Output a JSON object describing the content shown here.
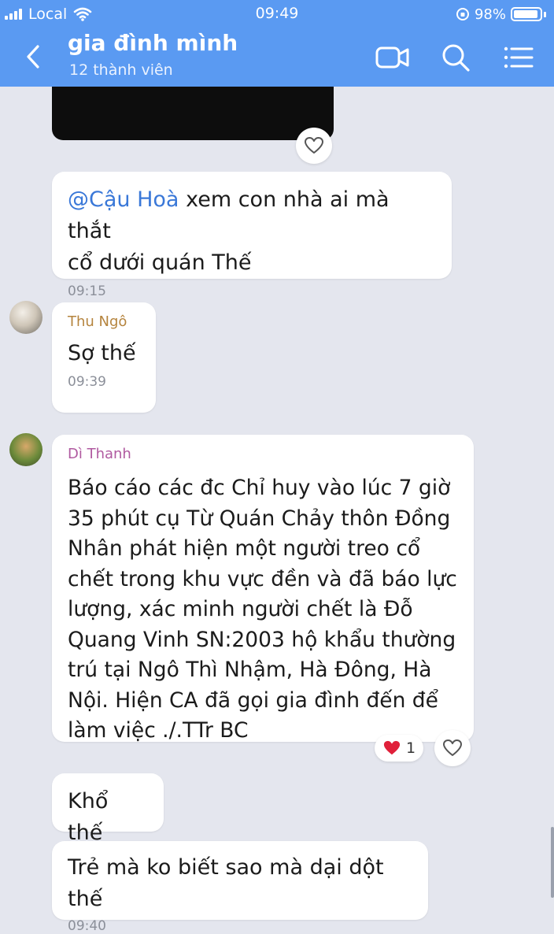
{
  "status_bar": {
    "carrier": "Local",
    "time": "09:49",
    "battery": "98%"
  },
  "header": {
    "title": "gia đình mình",
    "subtitle": "12 thành viên"
  },
  "colors": {
    "header": "#5a9af2",
    "background": "#e4e6ee",
    "mention": "#3a78d8",
    "sender_thu": "#b5843e",
    "sender_thanh": "#b05aa0",
    "heart": "#e0203a"
  },
  "icons": [
    "back-icon",
    "video-call-icon",
    "search-icon",
    "menu-icon",
    "heart-outline-icon",
    "heart-filled-icon"
  ],
  "messages": [
    {
      "mention": "@Cậu Hoà",
      "text_line1": "xem con nhà ai mà thắt",
      "text_line2": "cổ dưới quán Thế",
      "time": "09:15"
    },
    {
      "sender": "Thu Ngô",
      "text": "Sợ thế",
      "time": "09:39"
    },
    {
      "sender": "Dì Thanh",
      "lines": [
        "Báo cáo các đc Chỉ huy vào lúc 7 giờ",
        "35 phút cụ Từ Quán Chảy thôn Đồng",
        "Nhân phát hiện một người treo cổ",
        "chết trong khu vực đền và đã báo lực",
        "lượng, xác minh người chết là Đỗ",
        "Quang Vinh SN:2003 hộ khẩu thường",
        "trú tại Ngô Thì Nhậm, Hà Đông, Hà",
        "Nội. Hiện CA đã gọi gia đình đến để",
        "làm việc ./.TTr BC"
      ],
      "reaction_count": "1"
    },
    {
      "text": "Khổ thế"
    },
    {
      "text": "Trẻ mà ko biết sao mà dại dột thế",
      "time": "09:40"
    }
  ]
}
